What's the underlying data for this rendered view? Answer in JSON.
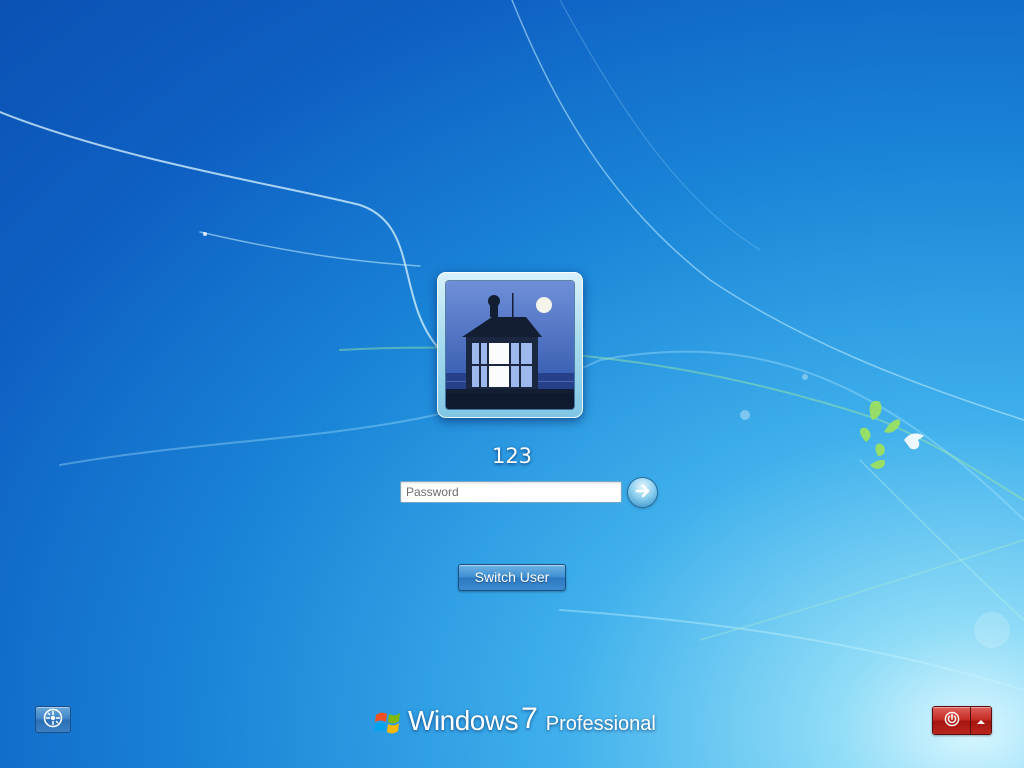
{
  "login": {
    "username": "123",
    "password_placeholder": "Password",
    "password_value": "",
    "switch_user_label": "Switch User"
  },
  "branding": {
    "product": "Windows",
    "version": "7",
    "edition": "Professional"
  },
  "icons": {
    "submit": "arrow-right-icon",
    "ease_of_access": "ease-of-access-icon",
    "power": "power-icon",
    "power_options": "chevron-up-icon",
    "logo": "windows-flag-icon"
  },
  "colors": {
    "background_primary": "#0e5fc2",
    "background_highlight": "#8fdcf7",
    "power_button": "#c22b24",
    "switch_user_button": "#3f8fd1"
  }
}
